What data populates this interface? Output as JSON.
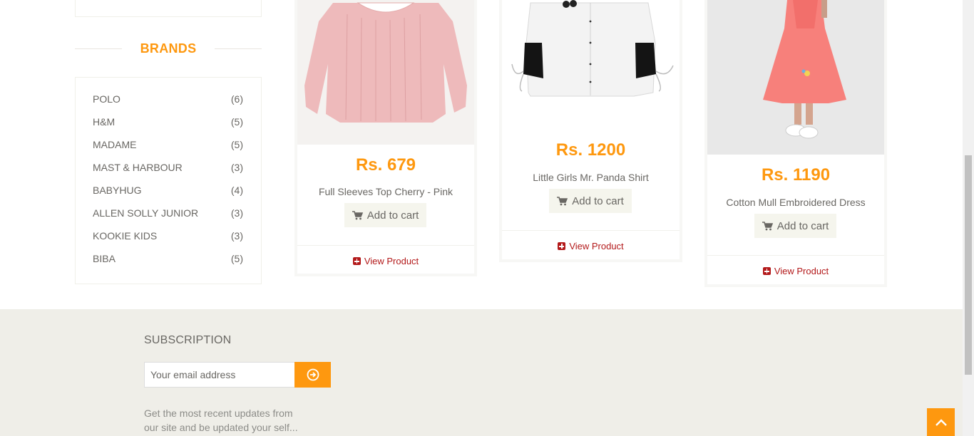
{
  "sidebar": {
    "brands_title": "BRANDS",
    "brands": [
      {
        "name": "POLO",
        "count": "(6)"
      },
      {
        "name": "H&M",
        "count": "(5)"
      },
      {
        "name": "MADAME",
        "count": "(5)"
      },
      {
        "name": "MAST & HARBOUR",
        "count": "(3)"
      },
      {
        "name": "BABYHUG",
        "count": "(4)"
      },
      {
        "name": "ALLEN SOLLY JUNIOR",
        "count": "(3)"
      },
      {
        "name": "KOOKIE KIDS",
        "count": "(3)"
      },
      {
        "name": "BIBA",
        "count": "(5)"
      }
    ]
  },
  "products": [
    {
      "price": "Rs. 679",
      "name": "Full Sleeves Top Cherry - Pink",
      "cart_label": "Add to cart",
      "view_label": "View Product"
    },
    {
      "price": "Rs. 1200",
      "name": "Little Girls Mr. Panda Shirt",
      "cart_label": "Add to cart",
      "view_label": "View Product"
    },
    {
      "price": "Rs. 1190",
      "name": "Cotton Mull Embroidered Dress",
      "cart_label": "Add to cart",
      "view_label": "View Product"
    }
  ],
  "footer": {
    "subscription_title": "SUBSCRIPTION",
    "email_placeholder": "Your email address",
    "description_line1": "Get the most recent updates from",
    "description_line2": "our site and be updated your self..."
  },
  "colors": {
    "accent": "#FE980F",
    "link": "#B3191A",
    "footer_bg": "#efeee8"
  },
  "icons": {
    "cart": "shopping-cart-icon",
    "view": "plus-square-icon",
    "subscribe": "arrow-circle-right-icon",
    "scroll": "chevron-up-icon"
  }
}
